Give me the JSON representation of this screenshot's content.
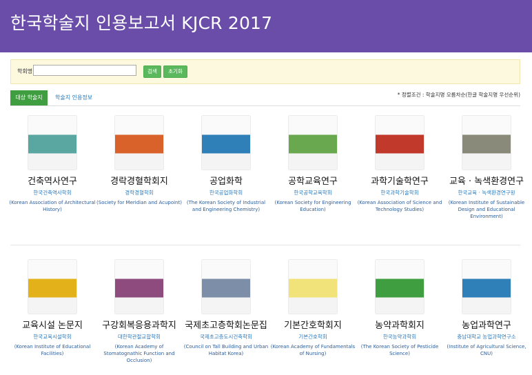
{
  "header": {
    "title": "한국학술지 인용보고서 KJCR 2017"
  },
  "search": {
    "label": "학회명",
    "value": "",
    "search_btn": "검색",
    "reset_btn": "초기화"
  },
  "tabs": {
    "active": "대상 학술지",
    "link": "학술지 인용정보"
  },
  "sort_note": "* 정렬조건 : 학술지명 오름차순(한글 학술지명 우선순위)",
  "journals": [
    {
      "title": "건축역사연구",
      "society_ko": "한국건축역사학회",
      "society_en": "(Korean Association of Architectural History)",
      "cover_color": "#5aa6a0"
    },
    {
      "title": "경락경혈학회지",
      "society_ko": "경락경혈학회",
      "society_en": "(Society for Meridian and Acupoint)",
      "cover_color": "#d9622b"
    },
    {
      "title": "공업화학",
      "society_ko": "한국공업화학회",
      "society_en": "(The Korean Society of Industrial and Engineering Chemistry)",
      "cover_color": "#2f7fb8"
    },
    {
      "title": "공학교육연구",
      "society_ko": "한국공학교육학회",
      "society_en": "(Korean Society for Engineering Education)",
      "cover_color": "#6aa84f"
    },
    {
      "title": "과학기술학연구",
      "society_ko": "한국과학기술학회",
      "society_en": "(Korean Association of Science and Technology Studies)",
      "cover_color": "#c0392b"
    },
    {
      "title": "교육 · 녹색환경연구",
      "society_ko": "한국교육 · 녹색환경연구원",
      "society_en": "(Korean Institute of Sustainable Design and Educational Environment)",
      "cover_color": "#8a8a7a"
    },
    {
      "title": "교육시설 논문지",
      "society_ko": "한국교육시설학회",
      "society_en": "(Korean Institute of Educational Facilities)",
      "cover_color": "#e3b21b"
    },
    {
      "title": "구강회복응용과학지",
      "society_ko": "대한학관절교합학회",
      "society_en": "(Korean Academy of Stomatognathic Function and Occlusion)",
      "cover_color": "#8e4b7e"
    },
    {
      "title": "국제초고층학회논문집",
      "society_ko": "국제초고층도시건축학회",
      "society_en": "(Council on Tall Building and Urban Habitat Korea)",
      "cover_color": "#7d8fa8"
    },
    {
      "title": "기본간호학회지",
      "society_ko": "기본간호학회",
      "society_en": "(Korean Academy of Fundamentals of Nursing)",
      "cover_color": "#f2e27a"
    },
    {
      "title": "농약과학회지",
      "society_ko": "한국농약과학회",
      "society_en": "(The Korean Society of Pesticide Science)",
      "cover_color": "#3f9e3f"
    },
    {
      "title": "농업과학연구",
      "society_ko": "충남대학교 농업과학연구소",
      "society_en": "(Institute of Agricultural Science, CNU)",
      "cover_color": "#2f7fb8"
    }
  ]
}
